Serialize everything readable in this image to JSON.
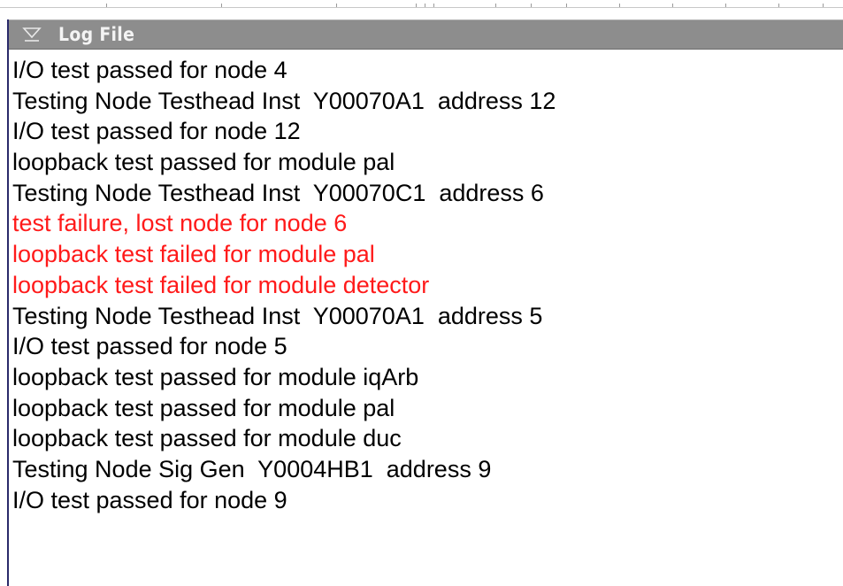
{
  "window": {
    "title": "Log File",
    "menu_icon": "triangle-down-icon"
  },
  "colors": {
    "normal_text": "#000000",
    "error_text": "#ff1a1a",
    "titlebar_bg": "#8d8d8d",
    "title_text": "#f4f4f4"
  },
  "log": {
    "lines": [
      {
        "text": "I/O test passed for node 4",
        "level": "info"
      },
      {
        "text": "Testing Node Testhead Inst  Y00070A1  address 12",
        "level": "info"
      },
      {
        "text": "I/O test passed for node 12",
        "level": "info"
      },
      {
        "text": "loopback test passed for module pal",
        "level": "info"
      },
      {
        "text": "Testing Node Testhead Inst  Y00070C1  address 6",
        "level": "info"
      },
      {
        "text": "test failure, lost node for node 6",
        "level": "error"
      },
      {
        "text": "loopback test failed for module pal",
        "level": "error"
      },
      {
        "text": "loopback test failed for module detector",
        "level": "error"
      },
      {
        "text": "Testing Node Testhead Inst  Y00070A1  address 5",
        "level": "info"
      },
      {
        "text": "I/O test passed for node 5",
        "level": "info"
      },
      {
        "text": "loopback test passed for module iqArb",
        "level": "info"
      },
      {
        "text": "loopback test passed for module pal",
        "level": "info"
      },
      {
        "text": "loopback test passed for module duc",
        "level": "info"
      },
      {
        "text": "Testing Node Sig Gen  Y0004HB1  address 9",
        "level": "info"
      },
      {
        "text": "I/O test passed for node 9",
        "level": "info"
      }
    ]
  }
}
